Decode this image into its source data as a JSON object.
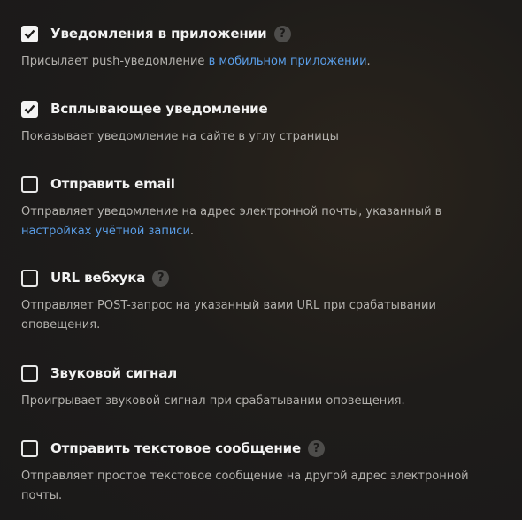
{
  "options": [
    {
      "label": "Уведомления в приложении",
      "checked": true,
      "help": "?",
      "desc_before": "Присылает push-уведомление ",
      "desc_link": "в мобильном приложении",
      "desc_after": "."
    },
    {
      "label": "Всплывающее уведомление",
      "checked": true,
      "desc_before": "Показывает уведомление на сайте в углу страницы"
    },
    {
      "label": "Отправить email",
      "checked": false,
      "desc_before": "Отправляет уведомление на адрес электронной почты, указанный в ",
      "desc_link": "настройках учётной записи",
      "desc_after": "."
    },
    {
      "label": "URL вебхука",
      "checked": false,
      "help": "?",
      "desc_before": "Отправляет POST-запрос на указанный вами URL при срабатывании оповещения."
    },
    {
      "label": "Звуковой сигнал",
      "checked": false,
      "desc_before": "Проигрывает звуковой сигнал при срабатывании оповещения."
    },
    {
      "label": "Отправить текстовое сообщение",
      "checked": false,
      "help": "?",
      "desc_before": "Отправляет простое текстовое сообщение на другой адрес электронной почты."
    }
  ]
}
